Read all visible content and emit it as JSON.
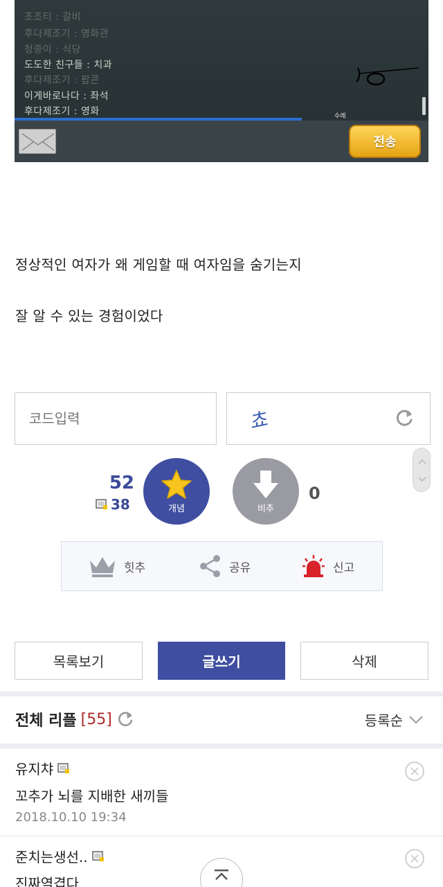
{
  "game_screenshot": {
    "chat_lines": [
      {
        "text": "조조티 : 갈비",
        "dim": true
      },
      {
        "text": "후다제조기 : 영화관",
        "dim": true
      },
      {
        "text": "청중이 : 식당",
        "dim": true
      },
      {
        "text": "도도한 친구들 : 치과",
        "dim": false
      },
      {
        "text": "후다제조기 : 팝콘",
        "dim": true
      },
      {
        "text": "이게바로나다 : 좌석",
        "dim": false
      },
      {
        "text": "후다제조기 : 영화",
        "dim": false
      }
    ],
    "small_label": "수레",
    "send_label": "전송"
  },
  "post": {
    "line1": "정상적인 여자가 왜 게임할 때 여자임을 숨기는지",
    "line2": "잘 알 수 있는 경험이었다"
  },
  "captcha": {
    "input_placeholder": "코드입력",
    "code_text": "쵸"
  },
  "votes": {
    "up_count": "52",
    "fix_count": "38",
    "up_label": "개념",
    "down_label": "비추",
    "down_count": "0"
  },
  "actions": {
    "hit_label": "힛추",
    "share_label": "공유",
    "report_label": "신고"
  },
  "buttons": {
    "list_label": "목록보기",
    "write_label": "글쓰기",
    "delete_label": "삭제"
  },
  "comments": {
    "title": "전체 리플",
    "count": "[55]",
    "sort_label": "등록순",
    "items": [
      {
        "author": "유지챠",
        "body": "꼬추가 뇌를 지배한 새끼들",
        "date": "2018.10.10 19:34"
      },
      {
        "author": "준치는생선..",
        "body": "진짜역겹다",
        "date": ""
      }
    ]
  },
  "colors": {
    "primary": "#3f4ea0",
    "down_gray": "#9a9ba2",
    "count_red": "#b02a2a",
    "send_gold": "#e6a413"
  }
}
